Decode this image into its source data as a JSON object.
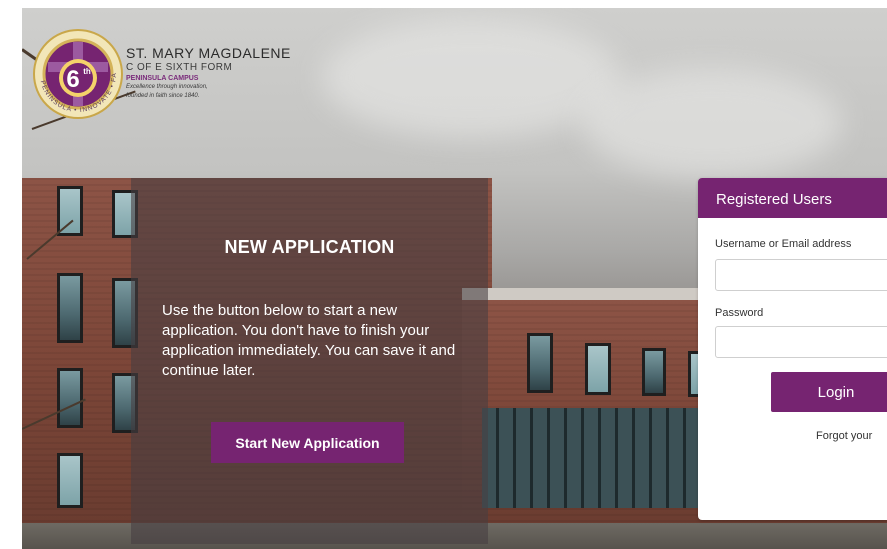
{
  "logo": {
    "badge_text": "6",
    "badge_sup": "th",
    "ring_text": "PENINSULA • INNOVATE • FAMILY",
    "title": "ST. MARY MAGDALENE",
    "subtitle": "C OF E SIXTH FORM",
    "campus": "PENINSULA CAMPUS",
    "motto_line1": "Excellence through innovation,",
    "motto_line2": "founded in faith since 1840."
  },
  "new_application": {
    "title": "NEW APPLICATION",
    "description": "Use the button below to start a new application. You don't have to finish your application immediately. You can save it and continue later.",
    "button_label": "Start New Application"
  },
  "login": {
    "header": "Registered Users",
    "username_label": "Username or Email address",
    "username_value": "",
    "password_label": "Password",
    "password_value": "",
    "button_label": "Login",
    "forgot_text": "Forgot your"
  },
  "colors": {
    "brand_purple": "#762471",
    "overlay": "#463e42"
  }
}
